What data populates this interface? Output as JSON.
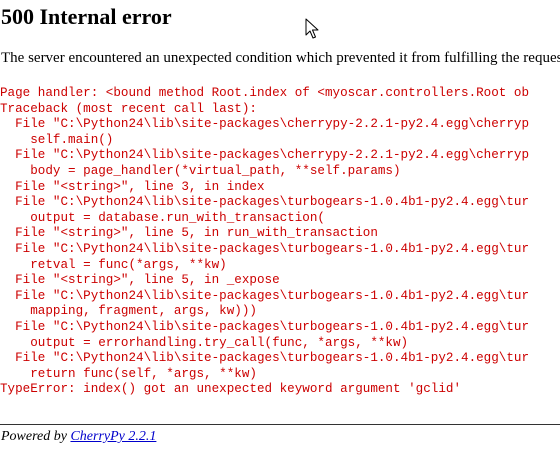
{
  "error": {
    "title": "500 Internal error",
    "message": "The server encountered an unexpected condition which prevented it from fulfilling the request.",
    "traceback_lines": [
      "Page handler: <bound method Root.index of <myoscar.controllers.Root ob",
      "Traceback (most recent call last):",
      "  File \"C:\\Python24\\lib\\site-packages\\cherrypy-2.2.1-py2.4.egg\\cherryp",
      "    self.main()",
      "  File \"C:\\Python24\\lib\\site-packages\\cherrypy-2.2.1-py2.4.egg\\cherryp",
      "    body = page_handler(*virtual_path, **self.params)",
      "  File \"<string>\", line 3, in index",
      "  File \"C:\\Python24\\lib\\site-packages\\turbogears-1.0.4b1-py2.4.egg\\tur",
      "    output = database.run_with_transaction(",
      "  File \"<string>\", line 5, in run_with_transaction",
      "  File \"C:\\Python24\\lib\\site-packages\\turbogears-1.0.4b1-py2.4.egg\\tur",
      "    retval = func(*args, **kw)",
      "  File \"<string>\", line 5, in _expose",
      "  File \"C:\\Python24\\lib\\site-packages\\turbogears-1.0.4b1-py2.4.egg\\tur",
      "    mapping, fragment, args, kw)))",
      "  File \"C:\\Python24\\lib\\site-packages\\turbogears-1.0.4b1-py2.4.egg\\tur",
      "    output = errorhandling.try_call(func, *args, **kw)",
      "  File \"C:\\Python24\\lib\\site-packages\\turbogears-1.0.4b1-py2.4.egg\\tur",
      "    return func(self, *args, **kw)",
      "TypeError: index() got an unexpected keyword argument 'gclid'"
    ],
    "traceback_color": "#cc0000"
  },
  "footer": {
    "powered_by": "Powered by",
    "link_text": "CherryPy 2.2.1",
    "link_color": "#0000cc"
  },
  "cursor": {
    "icon": "arrow-pointer-icon"
  }
}
